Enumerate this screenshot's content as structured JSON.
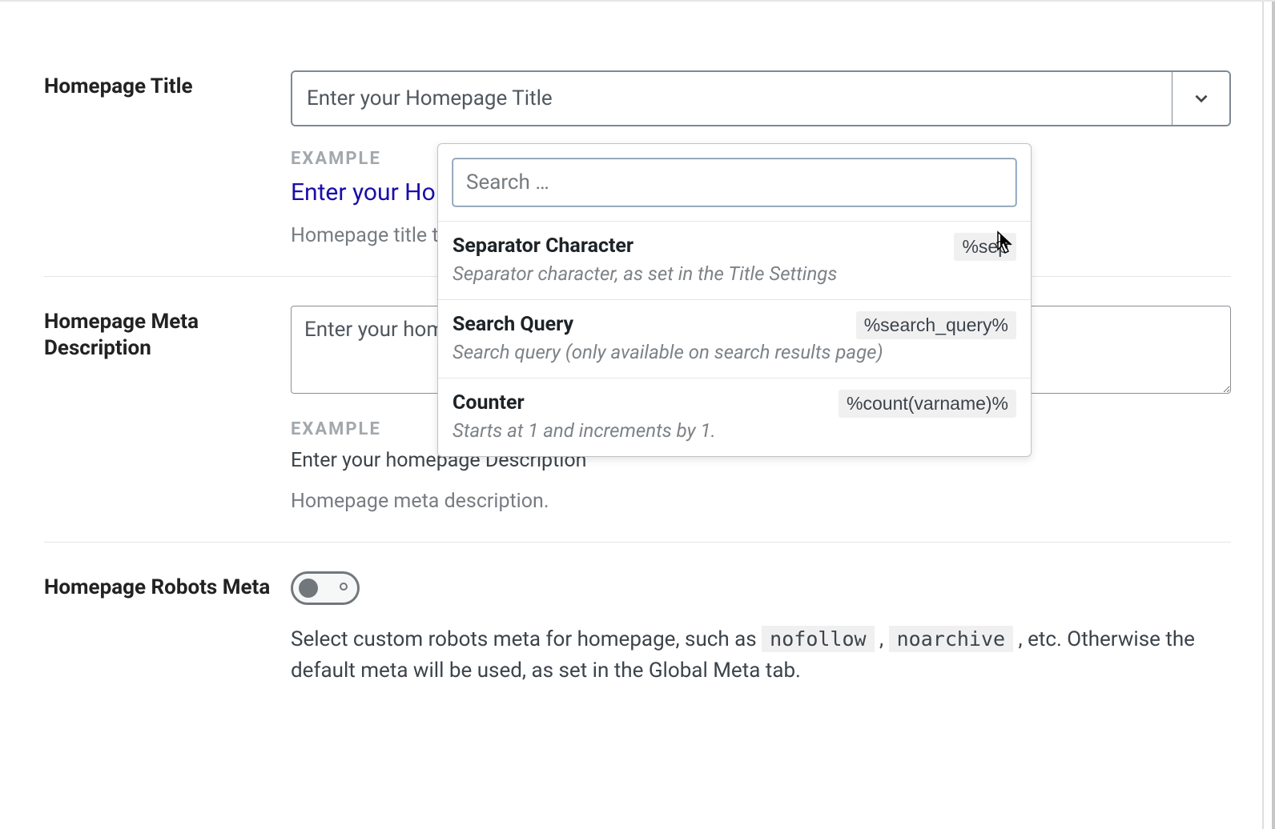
{
  "title": {
    "label": "Homepage Title",
    "placeholder": "Enter your Homepage Title",
    "example_label": "EXAMPLE",
    "example_value": "Enter your Ho",
    "help": "Homepage title t"
  },
  "meta": {
    "label": "Homepage Meta Description",
    "placeholder": "Enter your hom",
    "example_label": "EXAMPLE",
    "example_value": "Enter your homepage Description",
    "help": "Homepage meta description."
  },
  "robots": {
    "label": "Homepage Robots Meta",
    "text_before": "Select custom robots meta for homepage, such as ",
    "code1": "nofollow",
    "mid": " , ",
    "code2": "noarchive",
    "text_after": " , etc. Otherwise the default meta will be used, as set in the Global Meta tab."
  },
  "panel": {
    "search_placeholder": "Search …",
    "items": [
      {
        "title": "Separator Character",
        "desc": "Separator character, as set in the Title Settings",
        "token": "%sep"
      },
      {
        "title": "Search Query",
        "desc": "Search query (only available on search results page)",
        "token": "%search_query%"
      },
      {
        "title": "Counter",
        "desc": "Starts at 1 and increments by 1.",
        "token": "%count(varname)%"
      }
    ]
  }
}
